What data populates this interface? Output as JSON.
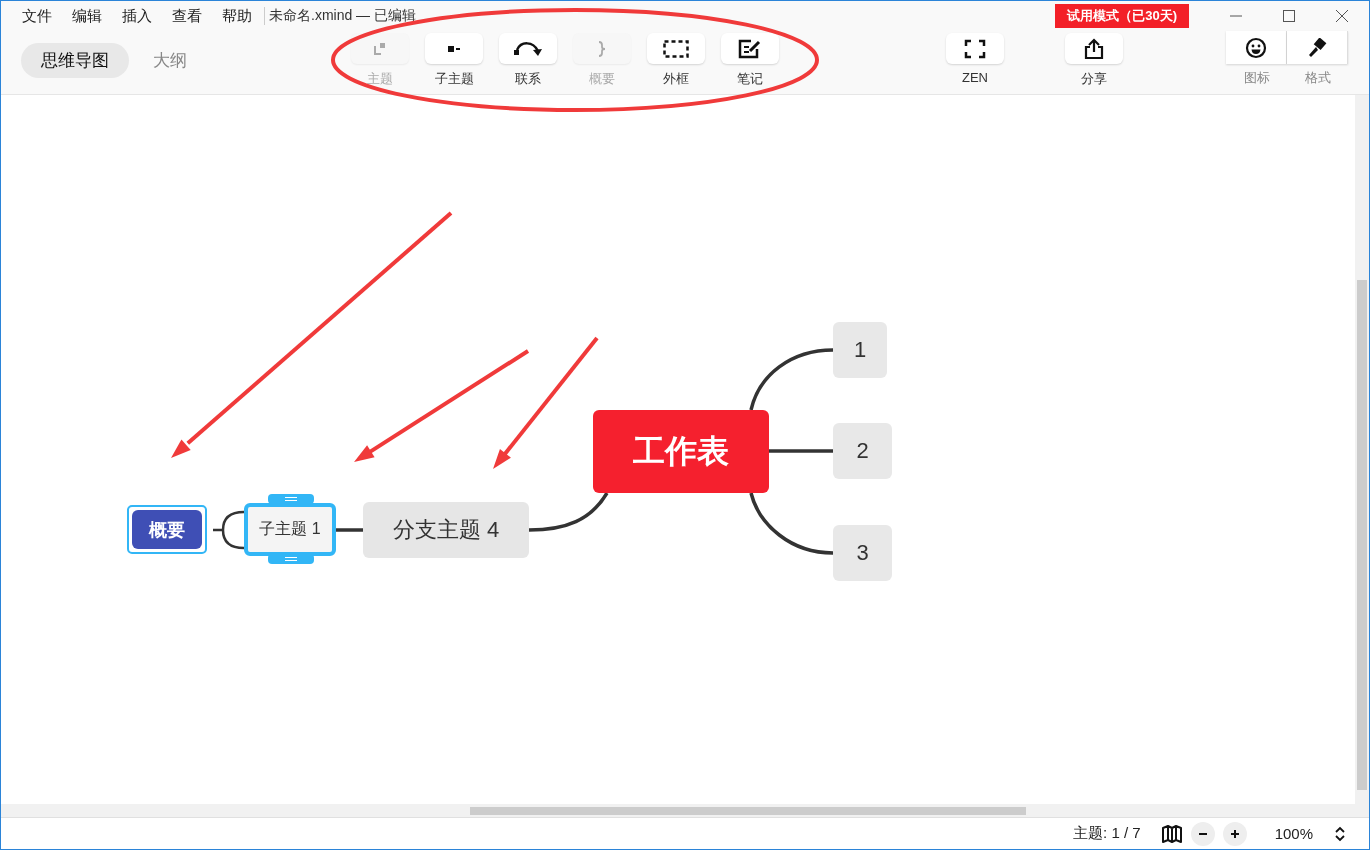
{
  "menu": [
    "文件",
    "编辑",
    "插入",
    "查看",
    "帮助"
  ],
  "window": {
    "title": "未命名.xmind — 已编辑",
    "badge": "试用模式（已30天)"
  },
  "view_tabs": [
    {
      "label": "思维导图",
      "selected": true
    },
    {
      "label": "大纲",
      "selected": false
    }
  ],
  "toolbar": [
    {
      "kind": "topic",
      "label": "主题",
      "disabled": true
    },
    {
      "kind": "subtopic",
      "label": "子主题",
      "disabled": false
    },
    {
      "kind": "relationship",
      "label": "联系",
      "disabled": false
    },
    {
      "kind": "summary",
      "label": "概要",
      "disabled": true
    },
    {
      "kind": "boundary",
      "label": "外框",
      "disabled": false
    },
    {
      "kind": "note",
      "label": "笔记",
      "disabled": false
    },
    {
      "kind": "zen",
      "label": "ZEN",
      "disabled": false
    },
    {
      "kind": "share",
      "label": "分享",
      "disabled": false
    }
  ],
  "panel_toggles": [
    {
      "kind": "icon",
      "label": "图标"
    },
    {
      "kind": "format",
      "label": "格式"
    }
  ],
  "mind_map": {
    "central_topic": "工作表",
    "right_topics": [
      {
        "label": "1"
      },
      {
        "label": "2"
      },
      {
        "label": "3"
      }
    ],
    "branch_topic": "分支主题 4",
    "subtopic": {
      "label": "子主题 1",
      "selected": true
    },
    "summary": "概要"
  },
  "annotations": [
    {
      "kind": "ellipse"
    },
    {
      "kind": "arrow"
    },
    {
      "kind": "arrow"
    },
    {
      "kind": "arrow"
    }
  ],
  "status_bar": {
    "topic_count": "主题: 1 / 7",
    "zoom": "100%"
  }
}
